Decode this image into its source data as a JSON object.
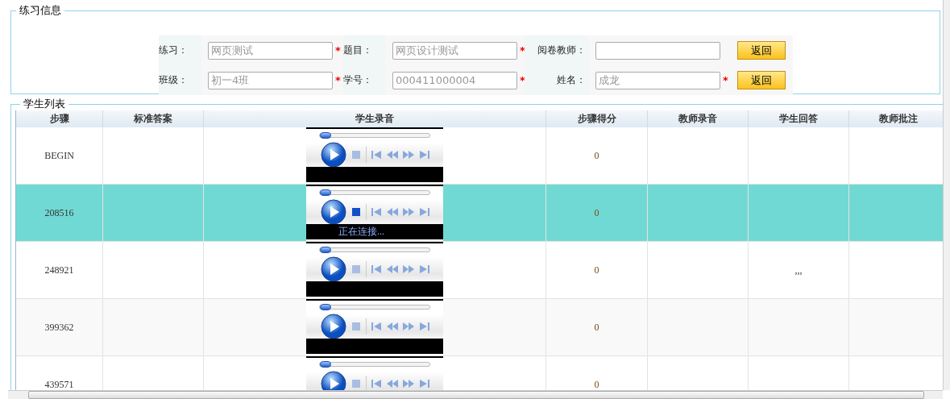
{
  "practice_info": {
    "title": "练习信息",
    "rows": [
      {
        "fields": [
          {
            "label": "练习：",
            "value": "网页测试",
            "marker": "*"
          },
          {
            "label": "题目：",
            "value": "网页设计测试",
            "marker": "*"
          },
          {
            "label": "阅卷教师："
          }
        ],
        "button": "返回"
      },
      {
        "fields": [
          {
            "label": "班级：",
            "value": "初一4班",
            "marker": "*"
          },
          {
            "label": "学号：",
            "value": "000411000004",
            "marker": "*"
          },
          {
            "label": "姓名：",
            "value": "成龙",
            "marker": "*"
          }
        ],
        "button": "返回"
      }
    ]
  },
  "student_list": {
    "title": "学生列表",
    "columns": [
      "步骤",
      "标准答案",
      "学生录音",
      "步骤得分",
      "教师录音",
      "学生回答",
      "教师批注"
    ],
    "rows": [
      {
        "step": "BEGIN",
        "score": "0",
        "selected": false,
        "player": {
          "level": 0,
          "stop_enabled": false
        }
      },
      {
        "step": "208516",
        "score": "0",
        "selected": true,
        "player": {
          "level": 0,
          "stop_enabled": true,
          "status": "正在连接..."
        }
      },
      {
        "step": "248921",
        "score": "0",
        "student_answer": ",,,",
        "selected": false,
        "player": {
          "level": 0,
          "stop_enabled": false
        }
      },
      {
        "step": "399362",
        "score": "0",
        "selected": false,
        "player": {
          "level": 0,
          "stop_enabled": false
        }
      },
      {
        "step": "439571",
        "score": "0",
        "selected": false,
        "player": {
          "level": 0,
          "stop_enabled": false
        }
      }
    ]
  }
}
